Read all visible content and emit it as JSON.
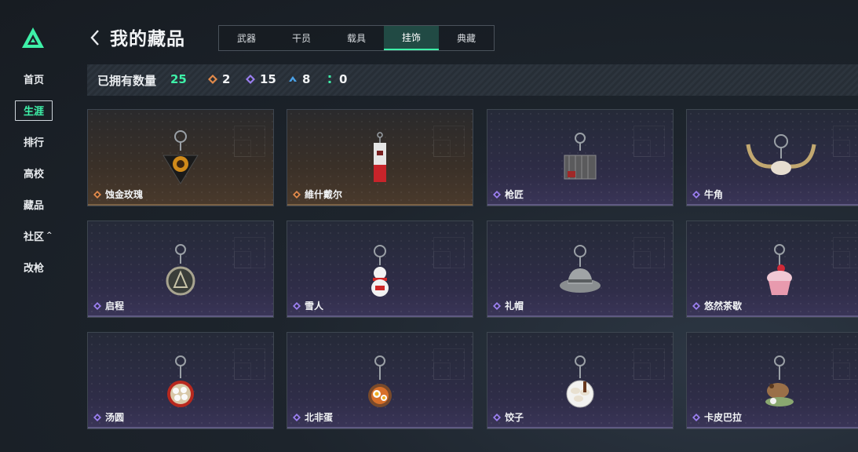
{
  "header": {
    "title": "我的藏品"
  },
  "sidebar": {
    "items": [
      {
        "label": "首页"
      },
      {
        "label": "生涯"
      },
      {
        "label": "排行"
      },
      {
        "label": "高校"
      },
      {
        "label": "藏品"
      },
      {
        "label": "社区"
      },
      {
        "label": "改枪"
      }
    ],
    "active_index": 1
  },
  "tabs": [
    {
      "label": "武器"
    },
    {
      "label": "干员"
    },
    {
      "label": "载具"
    },
    {
      "label": "挂饰"
    },
    {
      "label": "典藏"
    }
  ],
  "active_tab": "挂饰",
  "owned": {
    "label": "已拥有数量",
    "total": "25",
    "rarities": [
      {
        "icon": "gold-diamond-icon",
        "count": "2",
        "color": "#e38a4a"
      },
      {
        "icon": "purple-diamond-icon",
        "count": "15",
        "color": "#9b7ff0"
      },
      {
        "icon": "blue-chevron-icon",
        "count": "8",
        "color": "#4aa2e8"
      },
      {
        "icon": "green-dots-icon",
        "count": "0",
        "color": "#3ef0a8"
      }
    ]
  },
  "items": [
    {
      "name": "蚀金玫瑰",
      "rarity": "gold"
    },
    {
      "name": "維什戴尔",
      "rarity": "gold"
    },
    {
      "name": "枪匠",
      "rarity": "purple"
    },
    {
      "name": "牛角",
      "rarity": "purple"
    },
    {
      "name": "启程",
      "rarity": "purple"
    },
    {
      "name": "雪人",
      "rarity": "purple"
    },
    {
      "name": "礼帽",
      "rarity": "purple"
    },
    {
      "name": "悠然茶歇",
      "rarity": "purple"
    },
    {
      "name": "汤圆",
      "rarity": "purple"
    },
    {
      "name": "北非蛋",
      "rarity": "purple"
    },
    {
      "name": "饺子",
      "rarity": "purple"
    },
    {
      "name": "卡皮巴拉",
      "rarity": "purple"
    }
  ]
}
